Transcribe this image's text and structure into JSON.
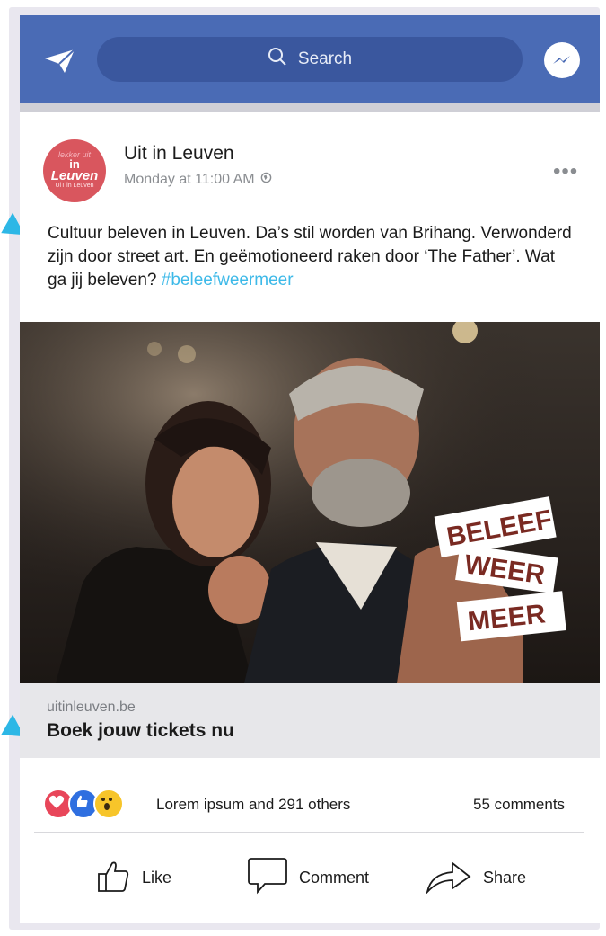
{
  "header": {
    "search_placeholder": "Search",
    "accent_color": "#4a6bb5"
  },
  "post": {
    "author": "Uit in Leuven",
    "timestamp": "Monday at 11:00 AM",
    "more_label": "•••",
    "caption": "Cultuur beleven in Leuven. Da’s stil worden van Brihang. Verwonderd zijn door street art. En geëmotioneerd raken door ‘The Father’. Wat ga jij beleven?",
    "hashtag": "#beleefweermeer",
    "avatar": {
      "line1": "lekker uit",
      "line2": "in",
      "line3": "Leuven",
      "line4": "UiT in Leuven"
    },
    "image_stickers": [
      "BELEEF",
      "WEER",
      "MEER"
    ],
    "link": {
      "domain": "uitinleuven.be",
      "headline": "Boek jouw tickets nu"
    },
    "reactions_summary": "Lorem ipsum and",
    "reactions_count": "291 others",
    "comments": "55 comments",
    "actions": {
      "like": "Like",
      "comment": "Comment",
      "share": "Share"
    }
  }
}
